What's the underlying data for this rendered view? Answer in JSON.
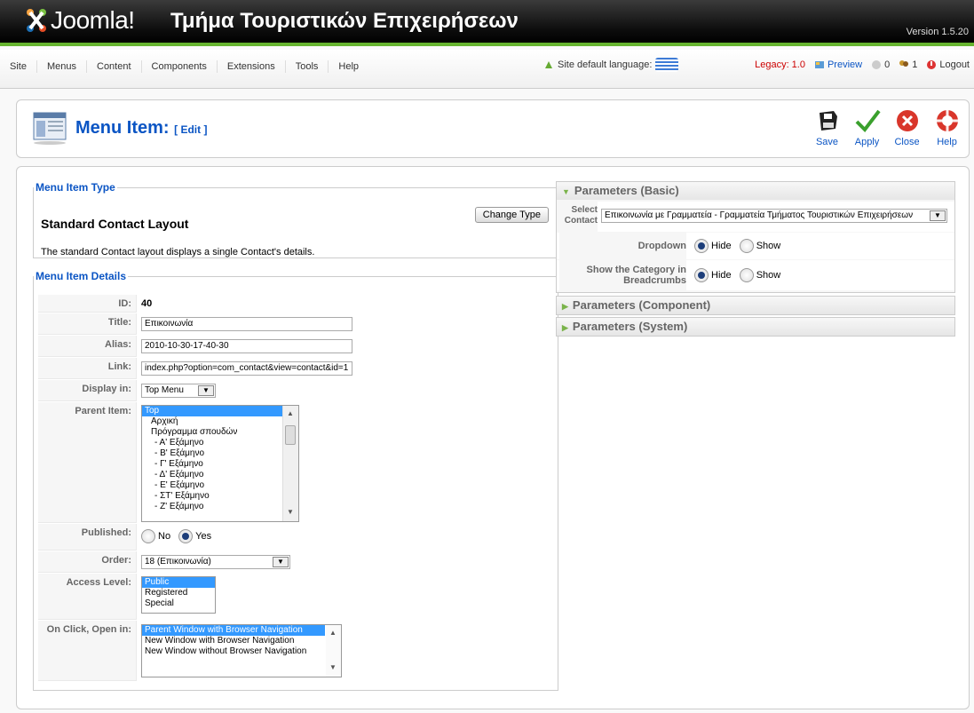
{
  "header": {
    "logo_text": "Joomla!",
    "site_title": "Τμήμα Τουριστικών Επιχειρήσεων",
    "version": "Version 1.5.20"
  },
  "menubar": {
    "items": [
      "Site",
      "Menus",
      "Content",
      "Components",
      "Extensions",
      "Tools",
      "Help"
    ],
    "site_language_label": "Site default language:",
    "legacy": "Legacy: 1.0",
    "preview": "Preview",
    "messages_count": "0",
    "users_count": "1",
    "logout": "Logout"
  },
  "toolbar": {
    "title": "Menu Item:",
    "subtitle": "[ Edit ]",
    "buttons": {
      "save": "Save",
      "apply": "Apply",
      "close": "Close",
      "help": "Help"
    }
  },
  "menu_item_type": {
    "legend": "Menu Item Type",
    "title": "Standard Contact Layout",
    "description": "The standard Contact layout displays a single Contact's details.",
    "change_type": "Change Type"
  },
  "details": {
    "legend": "Menu Item Details",
    "id_label": "ID:",
    "id_value": "40",
    "title_label": "Title:",
    "title_value": "Επικοινωνία",
    "alias_label": "Alias:",
    "alias_value": "2010-10-30-17-40-30",
    "link_label": "Link:",
    "link_value": "index.php?option=com_contact&view=contact&id=1",
    "display_label": "Display in:",
    "display_value": "Top Menu",
    "parent_label": "Parent Item:",
    "parent_options": [
      "Top",
      "Αρχική",
      "Πρόγραμμα σπουδών",
      "- Α' Εξάμηνο",
      "- Β' Εξάμηνο",
      "- Γ' Εξάμηνο",
      "- Δ' Εξάμηνο",
      "- Ε' Εξάμηνο",
      "- ΣΤ' Εξάμηνο",
      "- Ζ' Εξάμηνο"
    ],
    "published_label": "Published:",
    "published_no": "No",
    "published_yes": "Yes",
    "order_label": "Order:",
    "order_value": "18 (Επικοινωνία)",
    "access_label": "Access Level:",
    "access_options": [
      "Public",
      "Registered",
      "Special"
    ],
    "onclick_label": "On Click, Open in:",
    "onclick_options": [
      "Parent Window with Browser Navigation",
      "New Window with Browser Navigation",
      "New Window without Browser Navigation"
    ]
  },
  "parameters": {
    "basic": "Parameters (Basic)",
    "component": "Parameters (Component)",
    "system": "Parameters (System)",
    "select_contact_label_1": "Select",
    "select_contact_label_2": "Contact",
    "select_contact_value": "Επικοινωνία με Γραμματεία - Γραμματεία Τμήματος Τουριστικών Επιχειρήσεων",
    "dropdown_label": "Dropdown",
    "show_category_label_1": "Show the Category in",
    "show_category_label_2": "Breadcrumbs",
    "hide": "Hide",
    "show": "Show"
  },
  "colors": {
    "accent_green": "#65b32e",
    "link_blue": "#0b55c4",
    "selection": "#3399ff"
  }
}
